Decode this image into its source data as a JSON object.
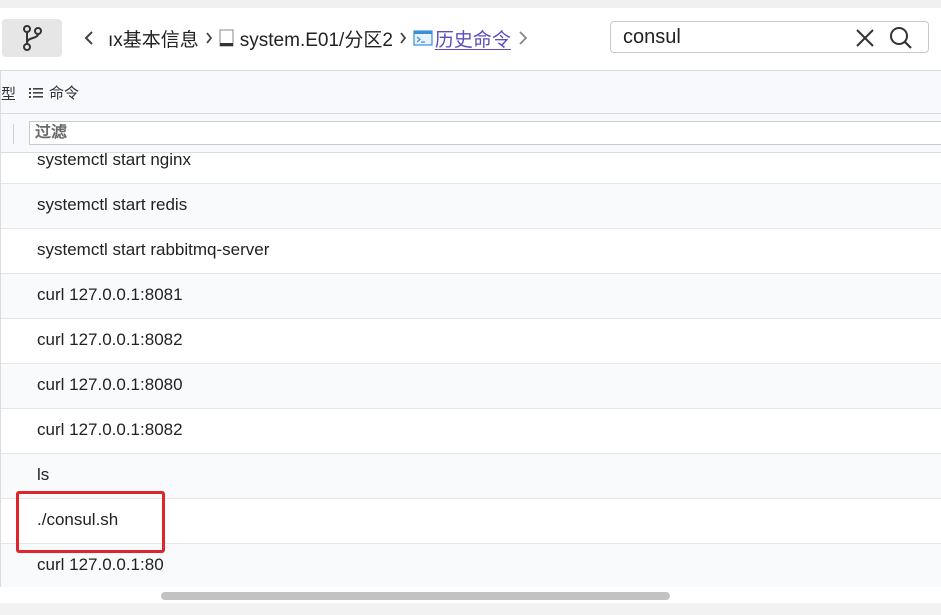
{
  "toolbar": {
    "branch_icon": "git-branch-icon",
    "back_icon": "chevron-left-icon",
    "forward_icon": "chevron-right-icon",
    "breadcrumbs": [
      {
        "label": "ıx基本信息",
        "icon": ""
      },
      {
        "label": "system.E01/分区2",
        "icon": "file-icon"
      },
      {
        "label": "历史命令",
        "icon": "terminal-icon"
      }
    ],
    "separator": "›"
  },
  "search": {
    "value": "consul",
    "clear_icon": "close-icon",
    "search_icon": "search-icon"
  },
  "table": {
    "columns": {
      "type_partial": "型",
      "command": "命令"
    },
    "filter_placeholder": "过滤",
    "rows": [
      "systemctl start nginx",
      "systemctl start redis",
      "systemctl start rabbitmq-server",
      "curl 127.0.0.1:8081",
      "curl 127.0.0.1:8082",
      "curl 127.0.0.1:8080",
      "curl 127.0.0.1:8082",
      "ls",
      "./consul.sh",
      "curl 127.0.0.1:80"
    ]
  },
  "colors": {
    "highlight_border": "#e0242b",
    "link": "#5b4fbf"
  }
}
